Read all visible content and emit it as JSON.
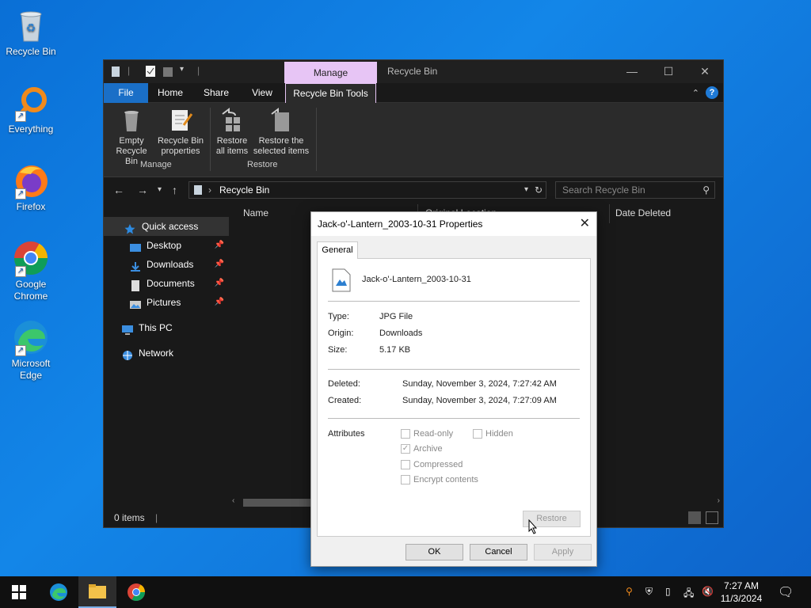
{
  "desktop": {
    "icons": [
      {
        "label": "Recycle Bin"
      },
      {
        "label": "Everything"
      },
      {
        "label": "Firefox"
      },
      {
        "label": "Google Chrome"
      },
      {
        "label": "Microsoft Edge"
      }
    ]
  },
  "explorer": {
    "manage_tab": "Manage",
    "title": "Recycle Bin",
    "tabs": {
      "file": "File",
      "home": "Home",
      "share": "Share",
      "view": "View",
      "tools": "Recycle Bin Tools"
    },
    "ribbon": {
      "empty": "Empty Recycle Bin",
      "props": "Recycle Bin properties",
      "restore_all": "Restore all items",
      "restore_sel": "Restore the selected items",
      "group_manage": "Manage",
      "group_restore": "Restore"
    },
    "address": "Recycle Bin",
    "search_placeholder": "Search Recycle Bin",
    "nav": {
      "quick_access": "Quick access",
      "desktop": "Desktop",
      "downloads": "Downloads",
      "documents": "Documents",
      "pictures": "Pictures",
      "this_pc": "This PC",
      "network": "Network"
    },
    "columns": {
      "name": "Name",
      "original_location": "Original Location",
      "date_deleted": "Date Deleted"
    },
    "status": "0 items"
  },
  "dialog": {
    "title": "Jack-o'-Lantern_2003-10-31 Properties",
    "tab": "General",
    "filename": "Jack-o'-Lantern_2003-10-31",
    "labels": {
      "type": "Type:",
      "origin": "Origin:",
      "size": "Size:",
      "deleted": "Deleted:",
      "created": "Created:",
      "attributes": "Attributes"
    },
    "values": {
      "type": "JPG File",
      "origin": "Downloads",
      "size": "5.17 KB",
      "deleted": "Sunday, November 3, 2024, 7:27:42 AM",
      "created": "Sunday, November 3, 2024, 7:27:09 AM"
    },
    "attrs": {
      "readonly": "Read-only",
      "hidden": "Hidden",
      "archive": "Archive",
      "compressed": "Compressed",
      "encrypt": "Encrypt contents"
    },
    "buttons": {
      "restore": "Restore",
      "ok": "OK",
      "cancel": "Cancel",
      "apply": "Apply"
    }
  },
  "taskbar": {
    "time": "7:27 AM",
    "date": "11/3/2024"
  }
}
